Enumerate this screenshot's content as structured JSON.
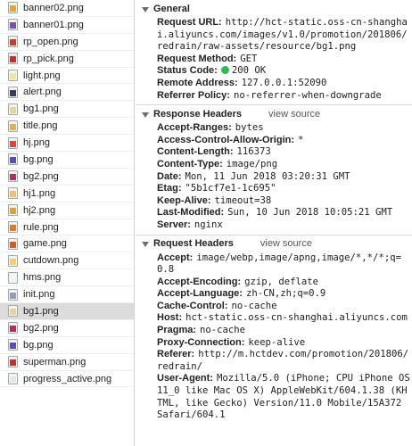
{
  "files": [
    {
      "name": "banner02.png",
      "icon": "image-file-icon",
      "color": "#e9a13b",
      "selected": false
    },
    {
      "name": "banner01.png",
      "icon": "image-file-icon",
      "color": "#7b4fb0",
      "selected": false
    },
    {
      "name": "rp_open.png",
      "icon": "image-file-icon",
      "color": "#d23a2c",
      "selected": false
    },
    {
      "name": "rp_pick.png",
      "icon": "image-file-icon",
      "color": "#c62f27",
      "selected": false
    },
    {
      "name": "light.png",
      "icon": "image-file-icon",
      "color": "#f3e2a0",
      "selected": false
    },
    {
      "name": "alert.png",
      "icon": "image-file-icon",
      "color": "#3a3a6a",
      "selected": false
    },
    {
      "name": "bg1.png",
      "icon": "image-file-icon",
      "color": "#e8d3a0",
      "selected": false
    },
    {
      "name": "title.png",
      "icon": "image-file-icon",
      "color": "#e2b05a",
      "selected": false
    },
    {
      "name": "hj.png",
      "icon": "image-file-icon",
      "color": "#d9463c",
      "selected": false
    },
    {
      "name": "bg.png",
      "icon": "image-file-icon",
      "color": "#5a4bb8",
      "selected": false
    },
    {
      "name": "bg2.png",
      "icon": "image-file-icon",
      "color": "#b52d5d",
      "selected": false
    },
    {
      "name": "hj1.png",
      "icon": "image-file-icon",
      "color": "#f0c070",
      "selected": false
    },
    {
      "name": "hj2.png",
      "icon": "image-file-icon",
      "color": "#e0a030",
      "selected": false
    },
    {
      "name": "rule.png",
      "icon": "image-file-icon",
      "color": "#e07a2a",
      "selected": false
    },
    {
      "name": "game.png",
      "icon": "image-file-icon",
      "color": "#d85a2a",
      "selected": false
    },
    {
      "name": "cutdown.png",
      "icon": "image-file-icon",
      "color": "#f0d070",
      "selected": false
    },
    {
      "name": "hms.png",
      "icon": "image-file-icon",
      "color": "#f4f4f4",
      "selected": false
    },
    {
      "name": "init.png",
      "icon": "image-file-icon",
      "color": "#9a9ab0",
      "selected": false
    },
    {
      "name": "bg1.png",
      "icon": "image-file-icon",
      "color": "#e8d3a0",
      "selected": true
    },
    {
      "name": "bg2.png",
      "icon": "image-file-icon",
      "color": "#b52d5d",
      "selected": false
    },
    {
      "name": "bg.png",
      "icon": "image-file-icon",
      "color": "#5a4bb8",
      "selected": false
    },
    {
      "name": "superman.png",
      "icon": "image-file-icon",
      "color": "#c8302a",
      "selected": false
    },
    {
      "name": "progress_active.png",
      "icon": "image-file-icon",
      "color": "#e8e8e8",
      "selected": false
    }
  ],
  "general": {
    "title": "General",
    "rows": [
      {
        "key": "Request URL:",
        "value": "http://hct-static.oss-cn-shanghai.aliyuncs.com/images/v1.0/promotion/201806/redrain/raw-assets/resource/bg1.png"
      },
      {
        "key": "Request Method:",
        "value": "GET"
      },
      {
        "key": "Status Code:",
        "value": "200 OK",
        "status": true
      },
      {
        "key": "Remote Address:",
        "value": "127.0.0.1:52090"
      },
      {
        "key": "Referrer Policy:",
        "value": "no-referrer-when-downgrade"
      }
    ]
  },
  "response": {
    "title": "Response Headers",
    "view_source": "view source",
    "rows": [
      {
        "key": "Accept-Ranges:",
        "value": "bytes"
      },
      {
        "key": "Access-Control-Allow-Origin:",
        "value": "*"
      },
      {
        "key": "Content-Length:",
        "value": "116373"
      },
      {
        "key": "Content-Type:",
        "value": "image/png"
      },
      {
        "key": "Date:",
        "value": "Mon, 11 Jun 2018 03:20:31 GMT"
      },
      {
        "key": "Etag:",
        "value": "\"5b1cf7e1-1c695\""
      },
      {
        "key": "Keep-Alive:",
        "value": "timeout=38"
      },
      {
        "key": "Last-Modified:",
        "value": "Sun, 10 Jun 2018 10:05:21 GMT"
      },
      {
        "key": "Server:",
        "value": "nginx"
      }
    ]
  },
  "request": {
    "title": "Request Headers",
    "view_source": "view source",
    "rows": [
      {
        "key": "Accept:",
        "value": "image/webp,image/apng,image/*,*/*;q=0.8"
      },
      {
        "key": "Accept-Encoding:",
        "value": "gzip, deflate"
      },
      {
        "key": "Accept-Language:",
        "value": "zh-CN,zh;q=0.9"
      },
      {
        "key": "Cache-Control:",
        "value": "no-cache"
      },
      {
        "key": "Host:",
        "value": "hct-static.oss-cn-shanghai.aliyuncs.com"
      },
      {
        "key": "Pragma:",
        "value": "no-cache"
      },
      {
        "key": "Proxy-Connection:",
        "value": "keep-alive"
      },
      {
        "key": "Referer:",
        "value": "http://m.hctdev.com/promotion/201806/redrain/"
      },
      {
        "key": "User-Agent:",
        "value": "Mozilla/5.0 (iPhone; CPU iPhone OS 11_0 like Mac OS X) AppleWebKit/604.1.38 (KHTML, like Gecko) Version/11.0 Mobile/15A372 Safari/604.1"
      }
    ]
  }
}
